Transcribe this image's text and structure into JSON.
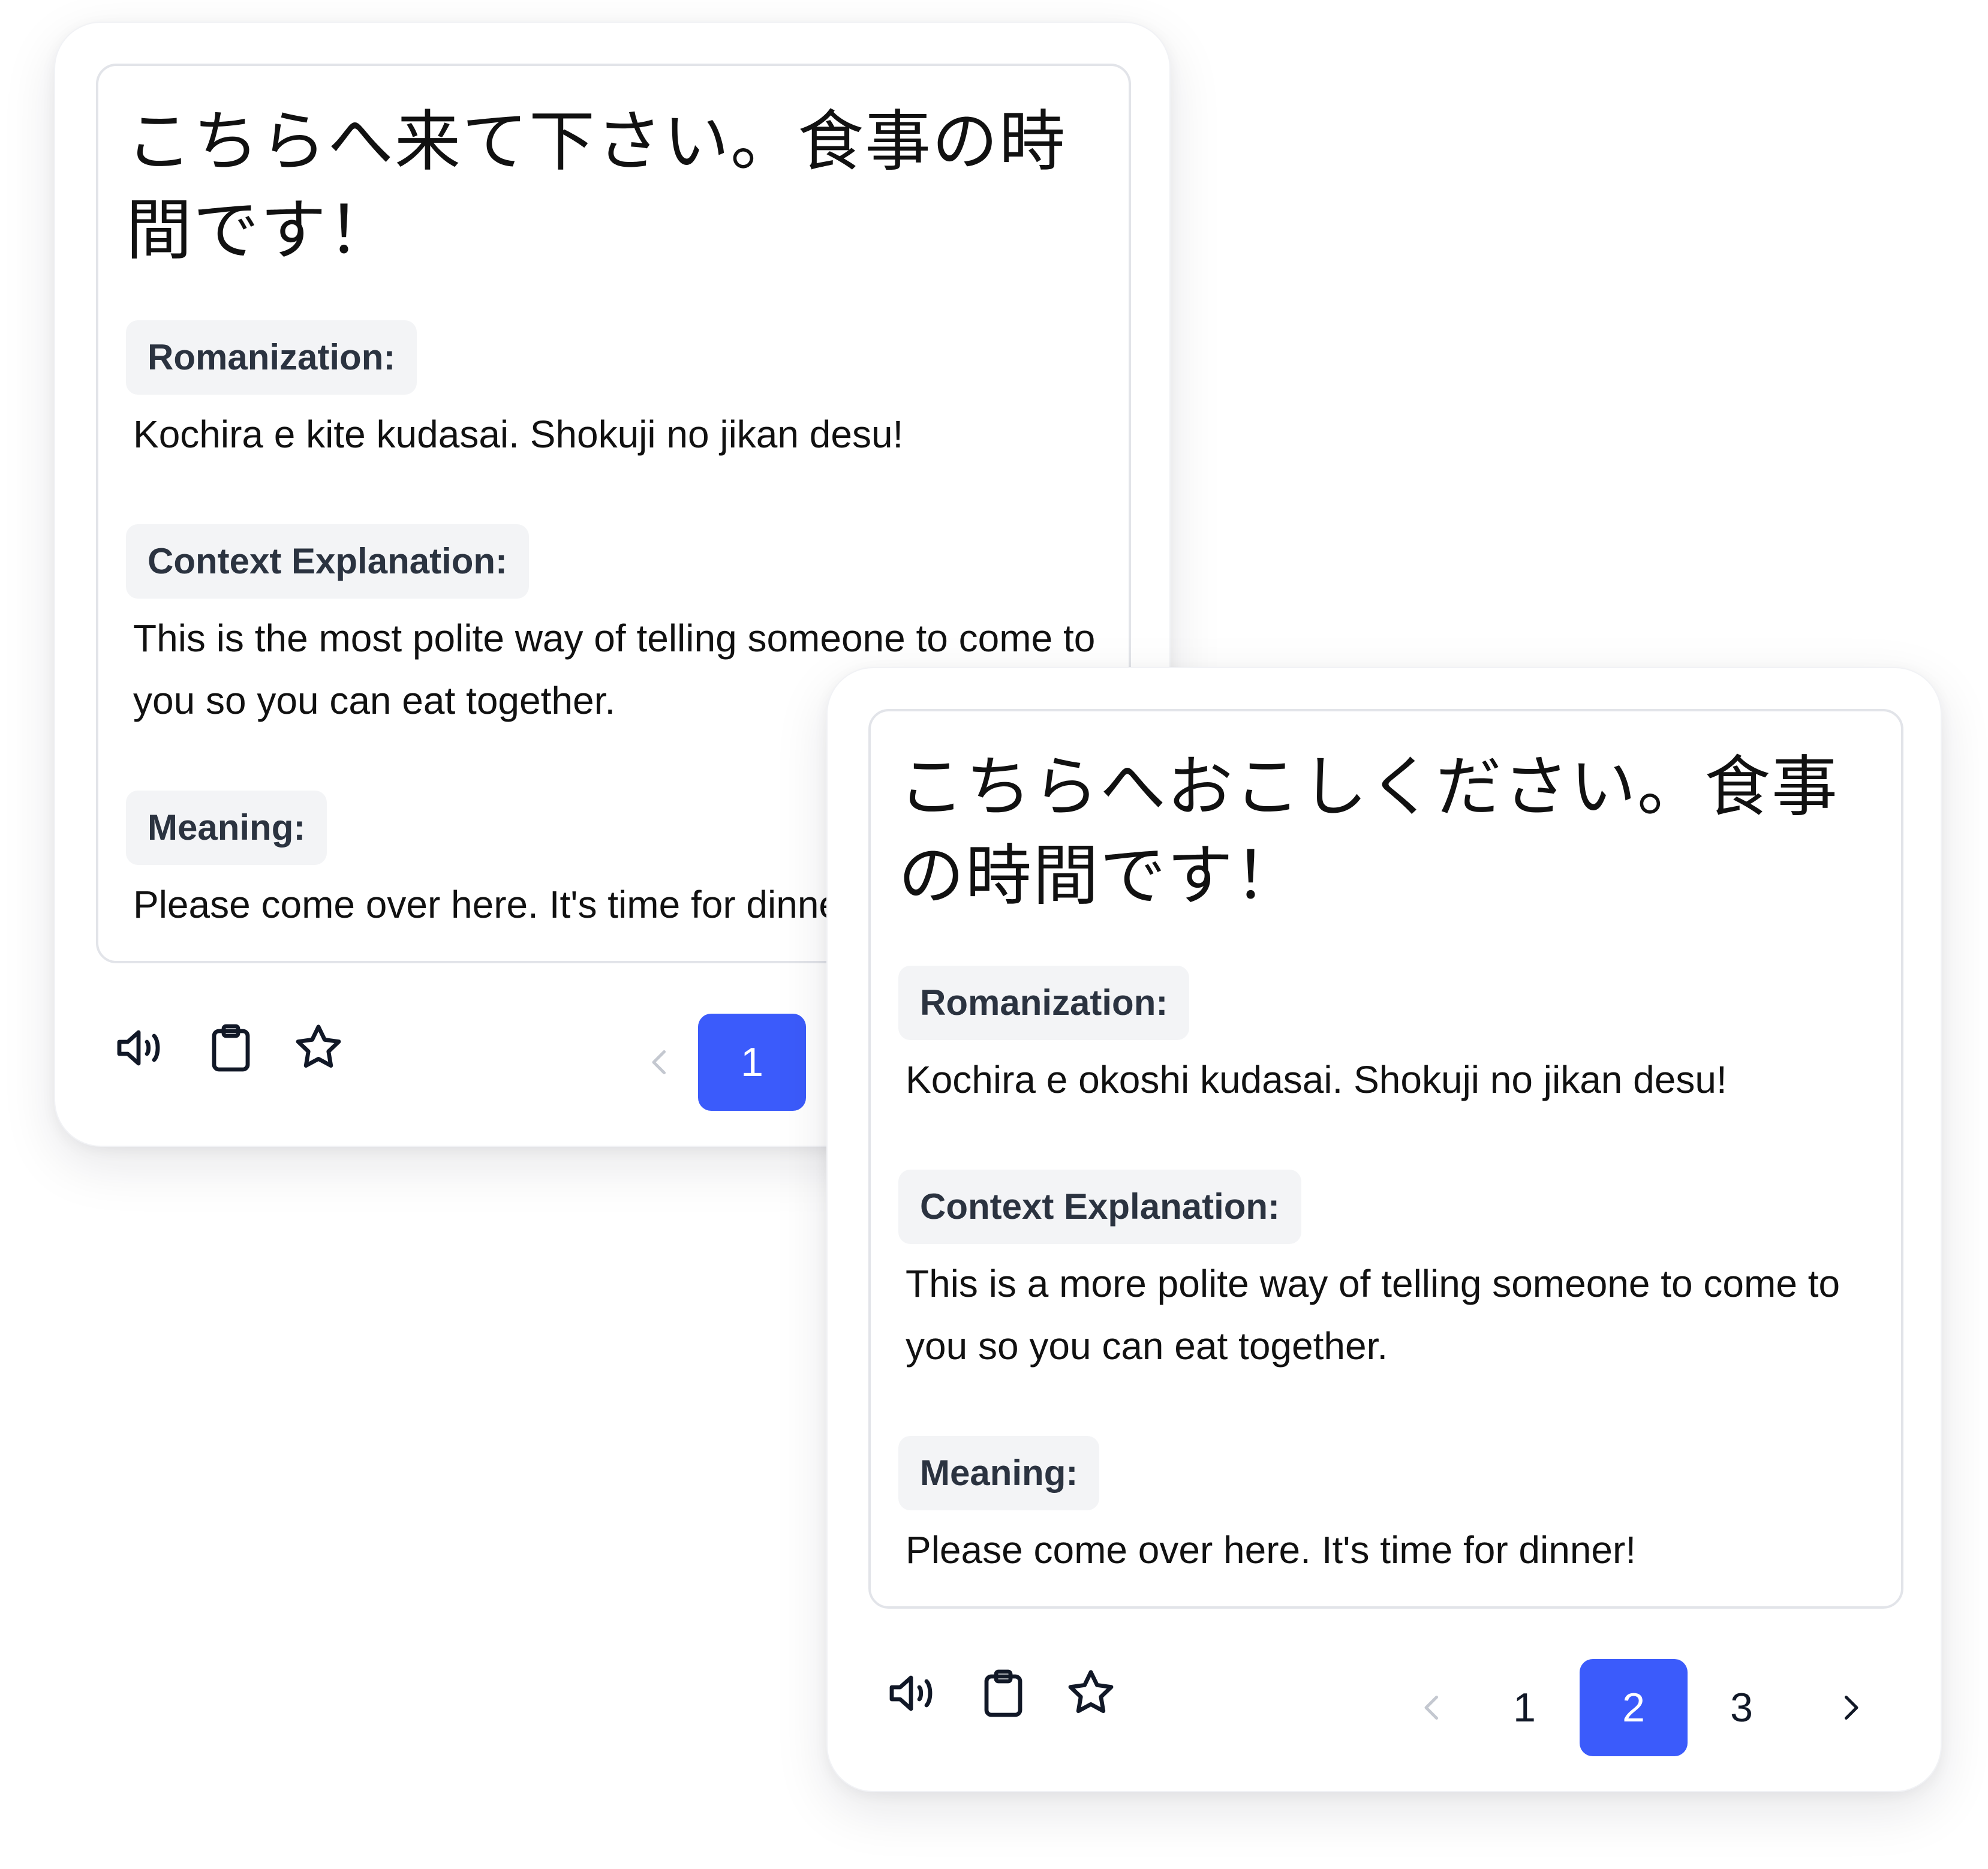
{
  "colors": {
    "accent": "#3b5bfb",
    "label_bg": "#f3f4f6",
    "border": "#e2e4e9",
    "disabled_arrow": "#c4c8d0"
  },
  "cards": [
    {
      "sentence": "こちらへ来て下さい。食事の時間です！",
      "romanization_label": "Romanization:",
      "romanization": "Kochira e kite kudasai. Shokuji no jikan desu!",
      "context_label": "Context Explanation:",
      "context": "This is the most polite way of telling someone to come to you so you can eat together.",
      "meaning_label": "Meaning:",
      "meaning": "Please come over here. It's time for dinner!",
      "actions": [
        "speaker-icon",
        "clipboard-icon",
        "star-icon"
      ],
      "pagination": {
        "prev": "chevron-left-icon",
        "pages": [
          "1"
        ],
        "current": "1"
      }
    },
    {
      "sentence": "こちらへおこしください。食事の時間です！",
      "romanization_label": "Romanization:",
      "romanization": "Kochira e okoshi kudasai. Shokuji no jikan desu!",
      "context_label": "Context Explanation:",
      "context": "This is a more polite way of telling someone to come to you so you can eat together.",
      "meaning_label": "Meaning:",
      "meaning": "Please come over here. It's time for dinner!",
      "actions": [
        "speaker-icon",
        "clipboard-icon",
        "star-icon"
      ],
      "pagination": {
        "prev": "chevron-left-icon",
        "pages": [
          "1",
          "2",
          "3"
        ],
        "current": "2",
        "next": "chevron-right-icon"
      }
    }
  ]
}
